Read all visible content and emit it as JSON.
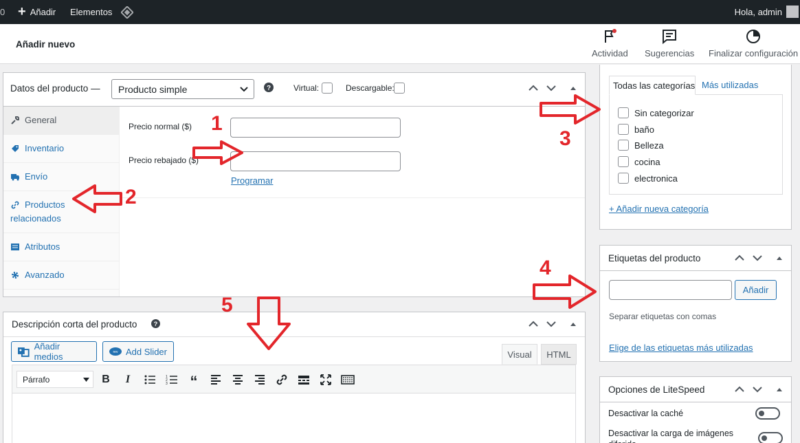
{
  "adminbar": {
    "counter": "0",
    "add_label": "Añadir",
    "elementos_label": "Elementos",
    "greeting": "Hola, admin"
  },
  "header": {
    "title": "Añadir nuevo",
    "buttons": [
      {
        "label": "Actividad",
        "icon": "flag-icon"
      },
      {
        "label": "Sugerencias",
        "icon": "message-icon"
      },
      {
        "label": "Finalizar configuración",
        "icon": "progress-circle-icon"
      }
    ]
  },
  "product_data": {
    "title": "Datos del producto —",
    "type_select": "Producto simple",
    "virtual_label": "Virtual:",
    "downloadable_label": "Descargable:",
    "tabs": [
      {
        "label": "General",
        "icon": "wrench-icon"
      },
      {
        "label": "Inventario",
        "icon": "tag-icon"
      },
      {
        "label": "Envío",
        "icon": "truck-icon"
      },
      {
        "label": "Productos relacionados",
        "label_line1": "Productos",
        "label_line2": "relacionados",
        "icon": "link-icon"
      },
      {
        "label": "Atributos",
        "icon": "table-icon"
      },
      {
        "label": "Avanzado",
        "icon": "gear-icon"
      }
    ],
    "regular_price_label": "Precio normal ($)",
    "regular_price_value": "",
    "sale_price_label": "Precio rebajado ($)",
    "sale_price_value": "",
    "schedule_link": "Programar"
  },
  "short_description": {
    "title": "Descripción corta del producto",
    "add_media": "Añadir medios",
    "add_slider": "Add Slider",
    "tab_visual": "Visual",
    "tab_html": "HTML",
    "format_select": "Párrafo"
  },
  "categories": {
    "tab_all": "Todas las categorías",
    "tab_most_used": "Más utilizadas",
    "items": [
      "Sin categorizar",
      "baño",
      "Belleza",
      "cocina",
      "electronica"
    ],
    "add_link": "+ Añadir nueva categoría"
  },
  "tags": {
    "title": "Etiquetas del producto",
    "input_value": "",
    "add_button": "Añadir",
    "help": "Separar etiquetas con comas",
    "choose_link": "Elige de las etiquetas más utilizadas"
  },
  "litespeed": {
    "title": "Opciones de LiteSpeed",
    "opt1": "Desactivar la caché",
    "opt2": "Desactivar la carga de imágenes diferida"
  },
  "annotations": [
    "1",
    "2",
    "3",
    "4",
    "5"
  ],
  "colors": {
    "accent": "#2271b1",
    "annotation": "#e3262b",
    "adminbar": "#1d2327"
  }
}
